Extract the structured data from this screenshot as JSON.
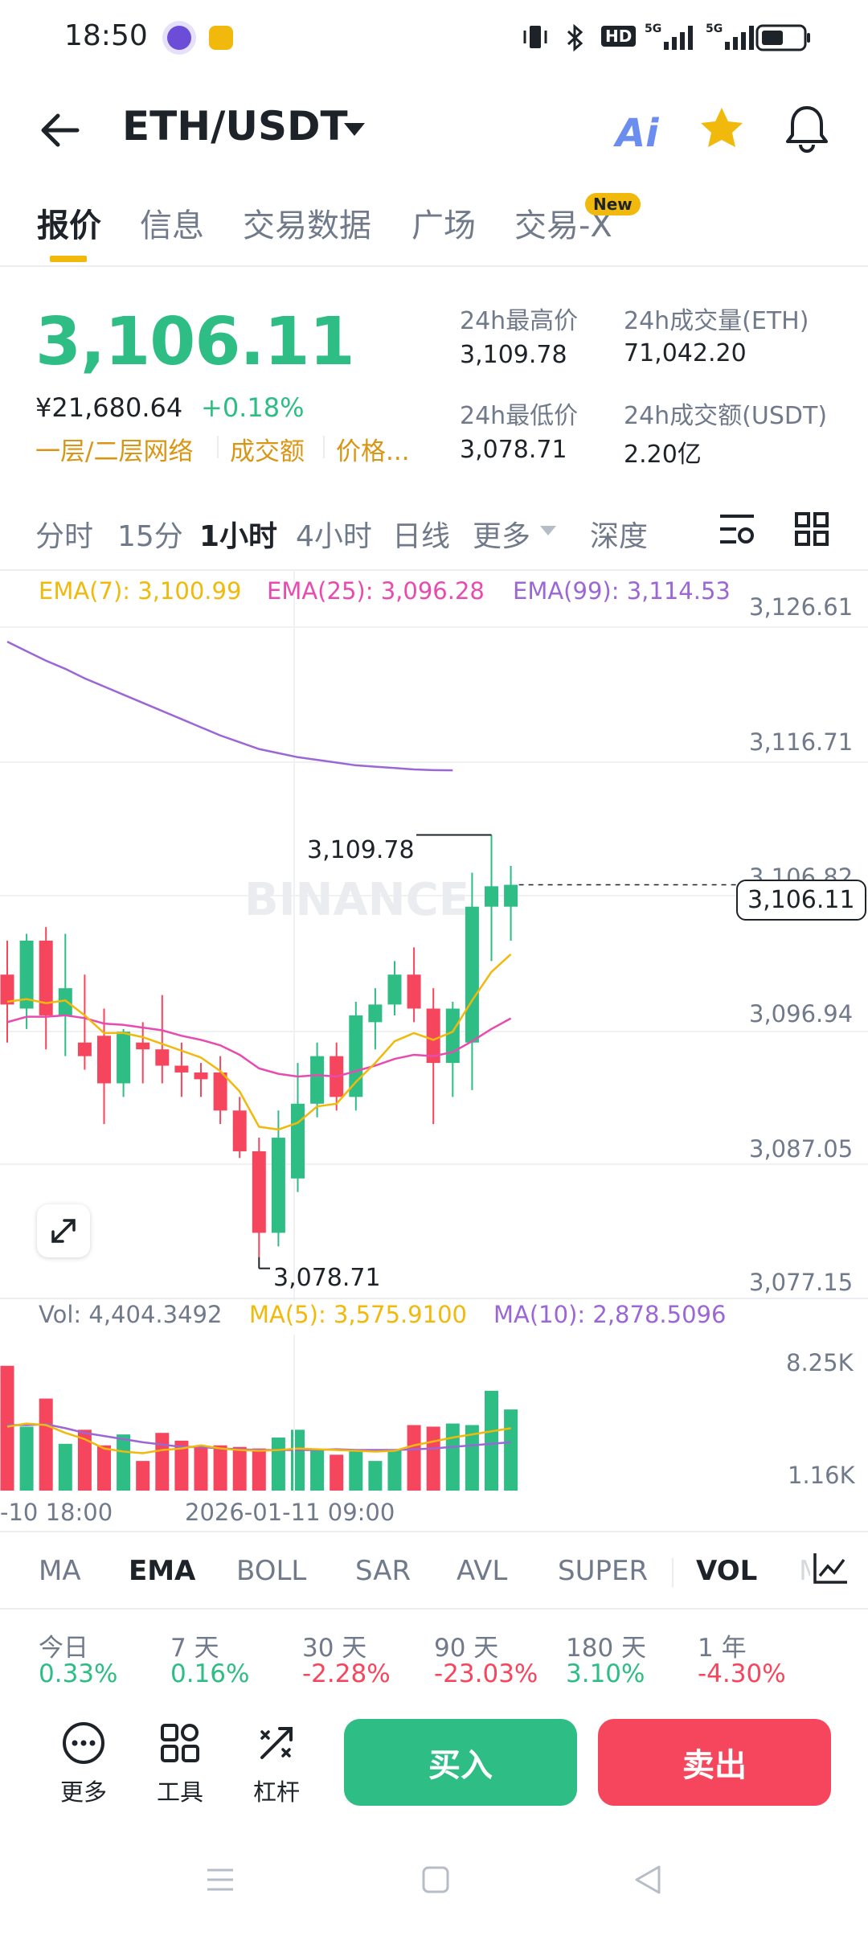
{
  "status_bar": {
    "time": "18:50",
    "network": "5G",
    "hd": "HD"
  },
  "header": {
    "title": "ETH/USDT",
    "ai_label": "Ai"
  },
  "tabs": [
    {
      "label": "报价",
      "active": true
    },
    {
      "label": "信息",
      "active": false
    },
    {
      "label": "交易数据",
      "active": false
    },
    {
      "label": "广场",
      "active": false
    },
    {
      "label": "交易-X",
      "active": false,
      "badge": "New"
    }
  ],
  "price": {
    "last": "3,106.11",
    "cny": "¥21,680.64",
    "change": "+0.18%",
    "tags": [
      "一层/二层网络",
      "成交额",
      "价格..."
    ]
  },
  "stats": [
    {
      "label": "24h最高价",
      "value": "3,109.78"
    },
    {
      "label": "24h成交量(ETH)",
      "value": "71,042.20"
    },
    {
      "label": "24h最低价",
      "value": "3,078.71"
    },
    {
      "label": "24h成交额(USDT)",
      "value": "2.20亿"
    }
  ],
  "intervals": [
    {
      "label": "分时",
      "active": false
    },
    {
      "label": "15分",
      "active": false
    },
    {
      "label": "1小时",
      "active": true
    },
    {
      "label": "4小时",
      "active": false
    },
    {
      "label": "日线",
      "active": false
    },
    {
      "label": "更多",
      "active": false
    },
    {
      "label": "深度",
      "active": false
    }
  ],
  "ema_legend": {
    "ema7": "EMA(7): 3,100.99",
    "ema25": "EMA(25): 3,096.28",
    "ema99": "EMA(99): 3,114.53"
  },
  "price_axis": [
    "3,126.61",
    "3,116.71",
    "3,106.82",
    "3,096.94",
    "3,087.05",
    "3,077.15"
  ],
  "current_price_label": "3,106.11",
  "high_label": "3,109.78",
  "low_label": "3,078.71",
  "watermark": "BINANCE",
  "vol_legend": {
    "vol": "Vol: 4,404.3492",
    "ma5": "MA(5): 3,575.9100",
    "ma10": "MA(10): 2,878.5096"
  },
  "vol_axis": [
    "8.25K",
    "1.16K"
  ],
  "time_axis": [
    "-10 18:00",
    "2026-01-11 09:00"
  ],
  "indicators": [
    {
      "label": "MA",
      "active": false
    },
    {
      "label": "EMA",
      "active": true
    },
    {
      "label": "BOLL",
      "active": false
    },
    {
      "label": "SAR",
      "active": false
    },
    {
      "label": "AVL",
      "active": false
    },
    {
      "label": "SUPER",
      "active": false
    },
    {
      "label": "VOL",
      "active": true
    },
    {
      "label": "M",
      "active": false
    }
  ],
  "performance": [
    {
      "label": "今日",
      "value": "0.33%",
      "dir": "up"
    },
    {
      "label": "7 天",
      "value": "0.16%",
      "dir": "up"
    },
    {
      "label": "30 天",
      "value": "-2.28%",
      "dir": "down"
    },
    {
      "label": "90 天",
      "value": "-23.03%",
      "dir": "down"
    },
    {
      "label": "180 天",
      "value": "3.10%",
      "dir": "up"
    },
    {
      "label": "1 年",
      "value": "-4.30%",
      "dir": "down"
    }
  ],
  "bottom_tools": [
    {
      "label": "更多",
      "icon": "more-dots-icon"
    },
    {
      "label": "工具",
      "icon": "tools-grid-icon"
    },
    {
      "label": "杠杆",
      "icon": "leverage-icon"
    }
  ],
  "buy_label": "买入",
  "sell_label": "卖出",
  "colors": {
    "up": "#2ebd85",
    "down": "#f6465d",
    "ema7": "#f0b90b",
    "ema25": "#e84bb0",
    "ema99": "#9b66d6",
    "accent": "#f0b90b"
  },
  "chart_data": {
    "type": "candlestick",
    "interval": "1小时",
    "ylim": [
      3077.15,
      3126.61
    ],
    "candles": [
      {
        "o": 3099.5,
        "h": 3102.0,
        "l": 3094.5,
        "c": 3097.3
      },
      {
        "o": 3097.0,
        "h": 3102.5,
        "l": 3095.5,
        "c": 3102.0
      },
      {
        "o": 3102.0,
        "h": 3103.0,
        "l": 3094.0,
        "c": 3096.5
      },
      {
        "o": 3096.5,
        "h": 3102.5,
        "l": 3093.5,
        "c": 3098.5
      },
      {
        "o": 3094.5,
        "h": 3099.5,
        "l": 3092.5,
        "c": 3093.5
      },
      {
        "o": 3095.0,
        "h": 3097.0,
        "l": 3088.5,
        "c": 3091.5
      },
      {
        "o": 3091.5,
        "h": 3095.5,
        "l": 3090.5,
        "c": 3095.3
      },
      {
        "o": 3094.5,
        "h": 3096.0,
        "l": 3091.5,
        "c": 3094.0
      },
      {
        "o": 3094.0,
        "h": 3098.0,
        "l": 3091.5,
        "c": 3092.8
      },
      {
        "o": 3092.8,
        "h": 3094.5,
        "l": 3090.5,
        "c": 3092.3
      },
      {
        "o": 3092.3,
        "h": 3093.0,
        "l": 3090.5,
        "c": 3091.8
      },
      {
        "o": 3092.3,
        "h": 3093.5,
        "l": 3088.5,
        "c": 3089.5
      },
      {
        "o": 3089.5,
        "h": 3090.5,
        "l": 3086.0,
        "c": 3086.5
      },
      {
        "o": 3086.5,
        "h": 3087.5,
        "l": 3078.7,
        "c": 3080.5
      },
      {
        "o": 3080.5,
        "h": 3089.5,
        "l": 3079.5,
        "c": 3087.5
      },
      {
        "o": 3084.5,
        "h": 3093.0,
        "l": 3083.5,
        "c": 3090.0
      },
      {
        "o": 3090.0,
        "h": 3094.5,
        "l": 3089.0,
        "c": 3093.5
      },
      {
        "o": 3093.5,
        "h": 3094.5,
        "l": 3089.5,
        "c": 3090.5
      },
      {
        "o": 3090.5,
        "h": 3097.5,
        "l": 3089.5,
        "c": 3096.5
      },
      {
        "o": 3096.0,
        "h": 3098.5,
        "l": 3094.0,
        "c": 3097.3
      },
      {
        "o": 3097.3,
        "h": 3100.5,
        "l": 3096.5,
        "c": 3099.5
      },
      {
        "o": 3099.5,
        "h": 3101.5,
        "l": 3096.0,
        "c": 3097.0
      },
      {
        "o": 3097.0,
        "h": 3098.5,
        "l": 3088.5,
        "c": 3093.0
      },
      {
        "o": 3093.0,
        "h": 3097.5,
        "l": 3090.5,
        "c": 3097.0
      },
      {
        "o": 3094.5,
        "h": 3107.0,
        "l": 3091.0,
        "c": 3104.5
      },
      {
        "o": 3104.5,
        "h": 3109.78,
        "l": 3100.5,
        "c": 3106.0
      },
      {
        "o": 3104.5,
        "h": 3107.5,
        "l": 3102.0,
        "c": 3106.11
      }
    ],
    "ema7": [
      3097.5,
      3097.7,
      3097.4,
      3097.6,
      3096.5,
      3095.2,
      3095.2,
      3094.9,
      3094.4,
      3093.9,
      3093.4,
      3092.4,
      3090.9,
      3088.3,
      3088.1,
      3088.6,
      3089.8,
      3090.0,
      3091.6,
      3093.0,
      3094.6,
      3095.2,
      3094.7,
      3095.3,
      3097.6,
      3099.7,
      3101.0
    ],
    "ema25": [
      3096.0,
      3096.4,
      3096.4,
      3096.5,
      3096.3,
      3095.9,
      3095.8,
      3095.6,
      3095.4,
      3095.0,
      3094.7,
      3094.3,
      3093.6,
      3092.6,
      3092.2,
      3092.0,
      3092.1,
      3092.0,
      3092.4,
      3092.8,
      3093.3,
      3093.6,
      3093.5,
      3093.8,
      3094.6,
      3095.5,
      3096.28
    ],
    "ema99": [
      3124.0,
      3123.3,
      3122.6,
      3122.0,
      3121.3,
      3120.7,
      3120.1,
      3119.5,
      3118.9,
      3118.3,
      3117.7,
      3117.1,
      3116.6,
      3116.1,
      3115.8,
      3115.5,
      3115.3,
      3115.1,
      3114.9,
      3114.8,
      3114.7,
      3114.6,
      3114.55,
      3114.53
    ],
    "volume": {
      "ylim": [
        0,
        10000
      ],
      "values": [
        8000,
        4100,
        5900,
        3000,
        3900,
        2900,
        3600,
        1900,
        3700,
        3200,
        2800,
        2900,
        2800,
        2700,
        3400,
        3900,
        2600,
        2300,
        2500,
        1900,
        2600,
        4200,
        4100,
        4300,
        4200,
        6400,
        5200
      ],
      "ma5": [
        4100,
        4300,
        4200,
        3700,
        3300,
        2700,
        2500,
        2400,
        2600,
        2700,
        2900,
        2700,
        2600,
        2550,
        2600,
        2700,
        2650,
        2600,
        2550,
        2500,
        2550,
        2900,
        3150,
        3400,
        3600,
        3800,
        4000
      ],
      "ma10": [
        4200,
        4200,
        4250,
        4000,
        3700,
        3500,
        3300,
        3100,
        2950,
        2800,
        2800,
        2700,
        2650,
        2600,
        2600,
        2600,
        2600,
        2650,
        2600,
        2600,
        2600,
        2650,
        2700,
        2800,
        2900,
        3000,
        3100
      ]
    }
  }
}
